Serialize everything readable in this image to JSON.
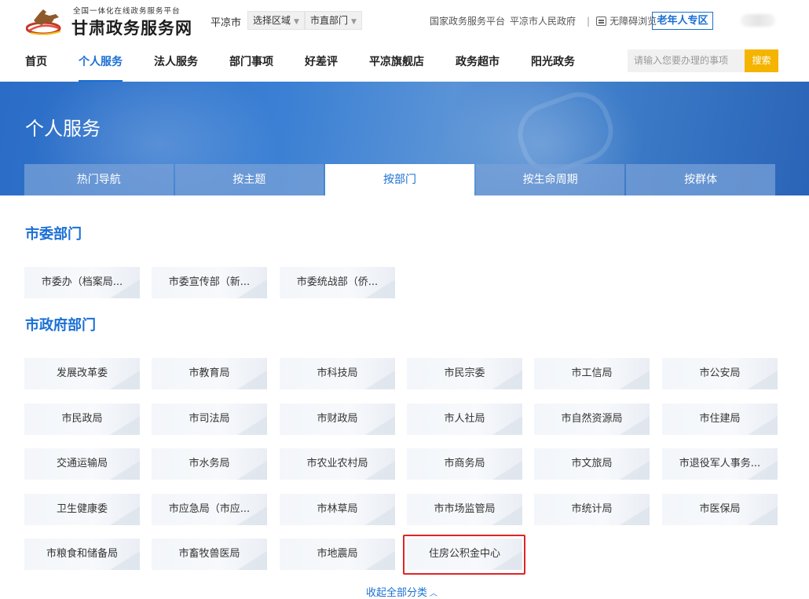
{
  "header": {
    "logo_small": "全国一体化在线政务服务平台",
    "logo_big": "甘肃政务服务网",
    "city": "平凉市",
    "region_select": "选择区域",
    "dept_select": "市直部门",
    "link_national": "国家政务服务平台",
    "link_gov": "平凉市人民政府",
    "link_access": "无障碍浏览",
    "elder_zone": "老年人专区"
  },
  "nav": {
    "items": [
      "首页",
      "个人服务",
      "法人服务",
      "部门事项",
      "好差评",
      "平凉旗舰店",
      "政务超市",
      "阳光政务"
    ],
    "active_index": 1,
    "search_placeholder": "请输入您要办理的事项",
    "search_button": "搜索"
  },
  "banner": {
    "title": "个人服务",
    "tabs": [
      "热门导航",
      "按主题",
      "按部门",
      "按生命周期",
      "按群体"
    ],
    "active_tab": 2
  },
  "sections": {
    "party": {
      "title": "市委部门",
      "items": [
        "市委办（档案局...",
        "市委宣传部（新...",
        "市委统战部（侨..."
      ]
    },
    "gov": {
      "title": "市政府部门",
      "items": [
        "发展改革委",
        "市教育局",
        "市科技局",
        "市民宗委",
        "市工信局",
        "市公安局",
        "市民政局",
        "市司法局",
        "市财政局",
        "市人社局",
        "市自然资源局",
        "市住建局",
        "交通运输局",
        "市水务局",
        "市农业农村局",
        "市商务局",
        "市文旅局",
        "市退役军人事务...",
        "卫生健康委",
        "市应急局（市应...",
        "市林草局",
        "市市场监管局",
        "市统计局",
        "市医保局",
        "市粮食和储备局",
        "市畜牧兽医局",
        "市地震局",
        "住房公积金中心"
      ],
      "highlighted_item": "住房公积金中心"
    }
  },
  "collapse_label": "收起全部分类",
  "colors": {
    "accent": "#1a6fd4",
    "search_button": "#f4b400",
    "highlight_border": "#e02424"
  }
}
